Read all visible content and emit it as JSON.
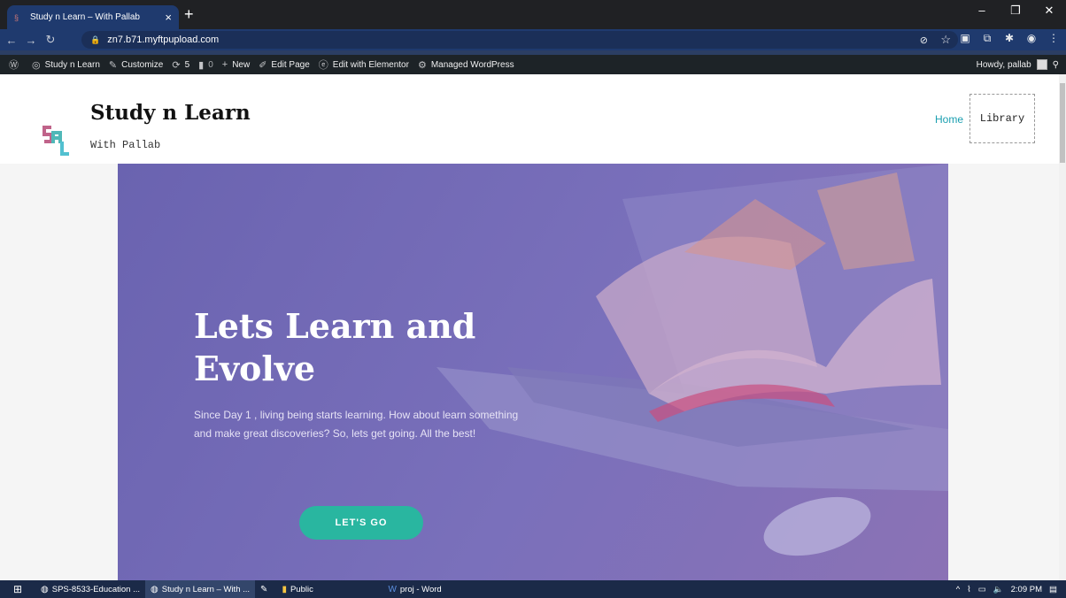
{
  "browser": {
    "tab_title": "Study n Learn – With Pallab",
    "tab_close": "×",
    "new_tab": "+",
    "url": "zn7.b71.myftpupload.com"
  },
  "admin_bar": {
    "site": "Study n Learn",
    "customize": "Customize",
    "updates": "5",
    "comments": "0",
    "new": "New",
    "edit_page": "Edit Page",
    "elementor": "Edit with Elementor",
    "managed": "Managed WordPress",
    "howdy": "Howdy, pallab"
  },
  "site": {
    "title": "Study n Learn",
    "tagline": "With Pallab",
    "menu": {
      "home": "Home",
      "library": "Library"
    }
  },
  "hero": {
    "title_line1": "Lets Learn and",
    "title_line2": "Evolve",
    "text": "Since Day 1 , living being starts learning. How about learn something and make great discoveries? So, lets get going. All the best!",
    "button": "LET'S GO"
  },
  "taskbar": {
    "items": [
      "SPS-8533-Education ...",
      "Study n Learn – With ...",
      "Public",
      "proj - Word"
    ],
    "time": "2:09 PM"
  },
  "colors": {
    "accent": "#29b6a0",
    "hero": "#6a63b0",
    "link": "#1a9fb0"
  }
}
